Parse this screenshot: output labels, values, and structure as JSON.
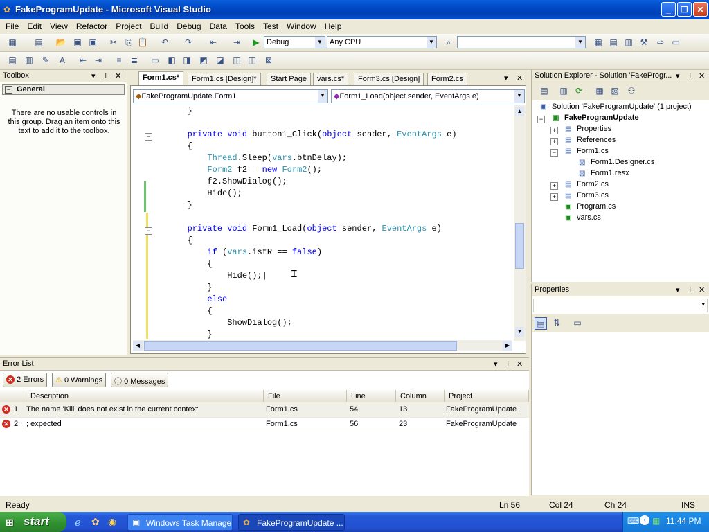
{
  "window": {
    "title": "FakeProgramUpdate - Microsoft Visual Studio"
  },
  "menu": [
    "File",
    "Edit",
    "View",
    "Refactor",
    "Project",
    "Build",
    "Debug",
    "Data",
    "Tools",
    "Test",
    "Window",
    "Help"
  ],
  "toolbar": {
    "config": "Debug",
    "platform": "Any CPU"
  },
  "toolbox": {
    "title": "Toolbox",
    "group": "General",
    "empty_text": "There are no usable controls in this group. Drag an item onto this text to add it to the toolbox."
  },
  "tabs": [
    "Form1.cs*",
    "Form1.cs [Design]*",
    "Start Page",
    "vars.cs*",
    "Form3.cs [Design]",
    "Form2.cs"
  ],
  "editor": {
    "class_combo": "FakeProgramUpdate.Form1",
    "member_combo": "Form1_Load(object sender, EventArgs e)"
  },
  "solution_explorer": {
    "title": "Solution Explorer - Solution 'FakeProgr...",
    "solution": "Solution 'FakeProgramUpdate' (1 project)",
    "project": "FakeProgramUpdate",
    "items": [
      "Properties",
      "References",
      "Form1.cs",
      "Form1.Designer.cs",
      "Form1.resx",
      "Form2.cs",
      "Form3.cs",
      "Program.cs",
      "vars.cs"
    ]
  },
  "properties": {
    "title": "Properties"
  },
  "error_list": {
    "title": "Error List",
    "errors_btn": "2 Errors",
    "warnings_btn": "0 Warnings",
    "messages_btn": "0 Messages",
    "columns": [
      "Description",
      "File",
      "Line",
      "Column",
      "Project"
    ],
    "rows": [
      {
        "num": "1",
        "desc": "The name 'Kill' does not exist in the current context",
        "file": "Form1.cs",
        "line": "54",
        "col": "13",
        "project": "FakeProgramUpdate"
      },
      {
        "num": "2",
        "desc": "; expected",
        "file": "Form1.cs",
        "line": "56",
        "col": "23",
        "project": "FakeProgramUpdate"
      }
    ]
  },
  "status": {
    "ready": "Ready",
    "ln": "Ln 56",
    "col": "Col 24",
    "ch": "Ch 24",
    "mode": "INS"
  },
  "taskbar": {
    "start": "start",
    "items": [
      "Windows Task Manager",
      "FakeProgramUpdate ..."
    ],
    "clock": "11:44 PM"
  }
}
